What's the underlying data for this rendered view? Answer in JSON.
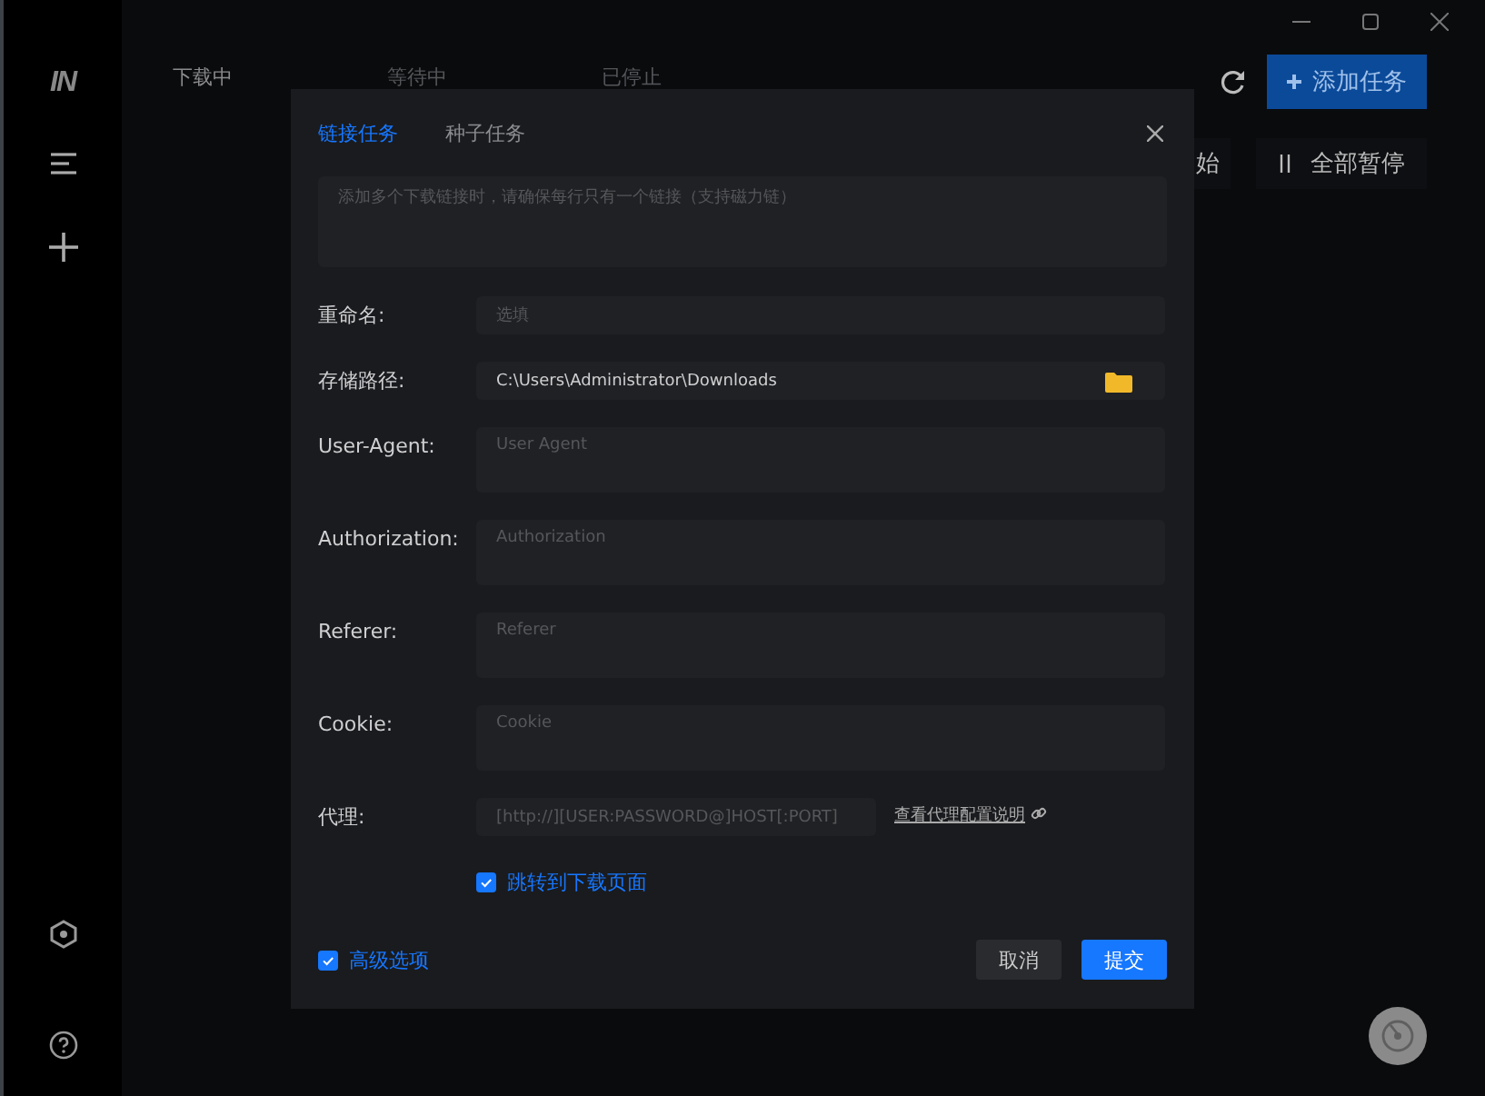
{
  "sidebar": {
    "logo": "IN"
  },
  "status_tabs": [
    {
      "label": "下载中",
      "selected": true
    },
    {
      "label": "等待中",
      "selected": false
    },
    {
      "label": "已停止",
      "selected": false
    }
  ],
  "toolbar": {
    "add_button": "添加任务",
    "start_all_partial": "始",
    "pause_all_button": "全部暂停"
  },
  "dialog": {
    "tabs": [
      {
        "label": "链接任务",
        "selected": true
      },
      {
        "label": "种子任务",
        "selected": false
      }
    ],
    "links_field": {
      "placeholder": "添加多个下载链接时，请确保每行只有一个链接（支持磁力链）"
    },
    "fields": [
      {
        "label": "重命名:",
        "placeholder": "选填",
        "kind": "single"
      },
      {
        "label": "存储路径:",
        "value": "C:\\Users\\Administrator\\Downloads",
        "kind": "path"
      },
      {
        "label": "User-Agent:",
        "placeholder": "User Agent",
        "kind": "multi"
      },
      {
        "label": "Authorization:",
        "placeholder": "Authorization",
        "kind": "multi"
      },
      {
        "label": "Referer:",
        "placeholder": "Referer",
        "kind": "multi"
      },
      {
        "label": "Cookie:",
        "placeholder": "Cookie",
        "kind": "multi"
      },
      {
        "label": "代理:",
        "placeholder": "[http://][USER:PASSWORD@]HOST[:PORT]",
        "kind": "proxy",
        "link": "查看代理配置说明"
      }
    ],
    "jump_option": {
      "label": "跳转到下载页面",
      "checked": true
    },
    "advanced_option": {
      "label": "高级选项",
      "checked": true
    },
    "buttons": [
      {
        "label": "取消",
        "kind": "secondary"
      },
      {
        "label": "提交",
        "kind": "primary"
      }
    ]
  }
}
